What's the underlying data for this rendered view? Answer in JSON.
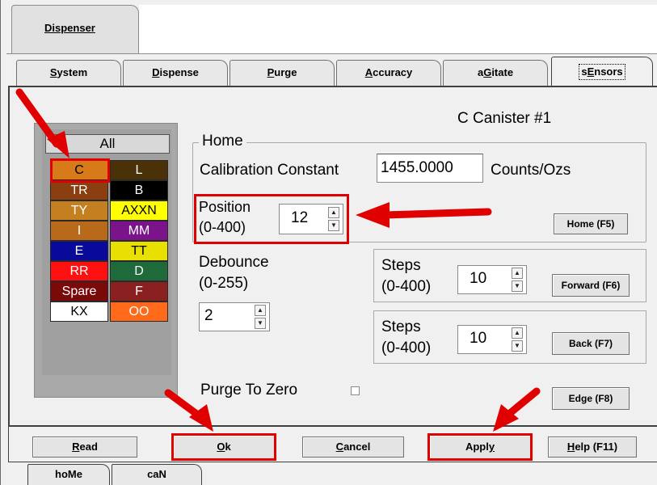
{
  "top_tab": {
    "label": "Dispenser"
  },
  "tabs": [
    {
      "label": "System",
      "ul": "S",
      "rest": "ystem"
    },
    {
      "label": "Dispense",
      "ul": "D",
      "rest": "ispense"
    },
    {
      "label": "Purge",
      "ul": "P",
      "rest": "urge"
    },
    {
      "label": "Accuracy",
      "ul": "A",
      "rest": "ccuracy"
    },
    {
      "label": "aGitate",
      "pre": "a",
      "ul": "G",
      "rest": "itate"
    },
    {
      "label": "sEnsors",
      "pre": "s",
      "ul": "E",
      "rest": "nsors"
    }
  ],
  "canister_title": "C Canister #1",
  "canister_list": {
    "all_label": "All",
    "cells": [
      {
        "label": "C",
        "bg": "#d67a1a",
        "fg": "#000000"
      },
      {
        "label": "L",
        "bg": "#4a3108",
        "fg": "#ffffff"
      },
      {
        "label": "TR",
        "bg": "#8b3f10",
        "fg": "#ffffff"
      },
      {
        "label": "B",
        "bg": "#000000",
        "fg": "#ffffff"
      },
      {
        "label": "TY",
        "bg": "#c48020",
        "fg": "#ffffff"
      },
      {
        "label": "AXXN",
        "bg": "#ffff00",
        "fg": "#000000"
      },
      {
        "label": "I",
        "bg": "#b86a1a",
        "fg": "#ffffff"
      },
      {
        "label": "MM",
        "bg": "#7b138b",
        "fg": "#ffffff"
      },
      {
        "label": "E",
        "bg": "#0a0a9a",
        "fg": "#ffffff"
      },
      {
        "label": "TT",
        "bg": "#e8e000",
        "fg": "#000000"
      },
      {
        "label": "RR",
        "bg": "#ff1010",
        "fg": "#ffffff"
      },
      {
        "label": "D",
        "bg": "#1e6a3a",
        "fg": "#ffffff"
      },
      {
        "label": "Spare",
        "bg": "#7a0a0a",
        "fg": "#ffffff"
      },
      {
        "label": "F",
        "bg": "#8a2020",
        "fg": "#ffffff"
      },
      {
        "label": "KX",
        "bg": "#ffffff",
        "fg": "#000000"
      },
      {
        "label": "OO",
        "bg": "#ff6a1a",
        "fg": "#ffffff"
      }
    ]
  },
  "home": {
    "legend": "Home",
    "cal_label": "Calibration Constant",
    "cal_value": "1455.0000",
    "cal_unit": "Counts/Ozs",
    "position_label": "Position",
    "position_range": "(0-400)",
    "position_value": "12",
    "home_button": "Home (F5)"
  },
  "debounce": {
    "label": "Debounce",
    "range": "(0-255)",
    "value": "2"
  },
  "forward": {
    "label": "Steps",
    "range": "(0-400)",
    "value": "10",
    "button": "Forward (F6)"
  },
  "back": {
    "label": "Steps",
    "range": "(0-400)",
    "value": "10",
    "button": "Back (F7)"
  },
  "purge_to_zero": {
    "label": "Purge To Zero"
  },
  "edge_button": "Edge (F8)",
  "bottom_buttons": [
    {
      "label": "Read",
      "ul": "R",
      "rest": "ead"
    },
    {
      "label": "Ok",
      "ul": "O",
      "rest": "k"
    },
    {
      "label": "Cancel",
      "ul": "C",
      "rest": "ancel"
    },
    {
      "label": "Apply",
      "pre": "Appl",
      "ul": "y",
      "rest": ""
    },
    {
      "label": "Help (F11)",
      "ul": "H",
      "rest": "elp (F11)"
    }
  ],
  "bottom_tabs": [
    {
      "label": "hoMe",
      "pre": "ho",
      "ul": "M",
      "rest": "e"
    },
    {
      "label": "caN",
      "pre": "ca",
      "ul": "N",
      "rest": ""
    }
  ],
  "annotation_color": "#e00000"
}
